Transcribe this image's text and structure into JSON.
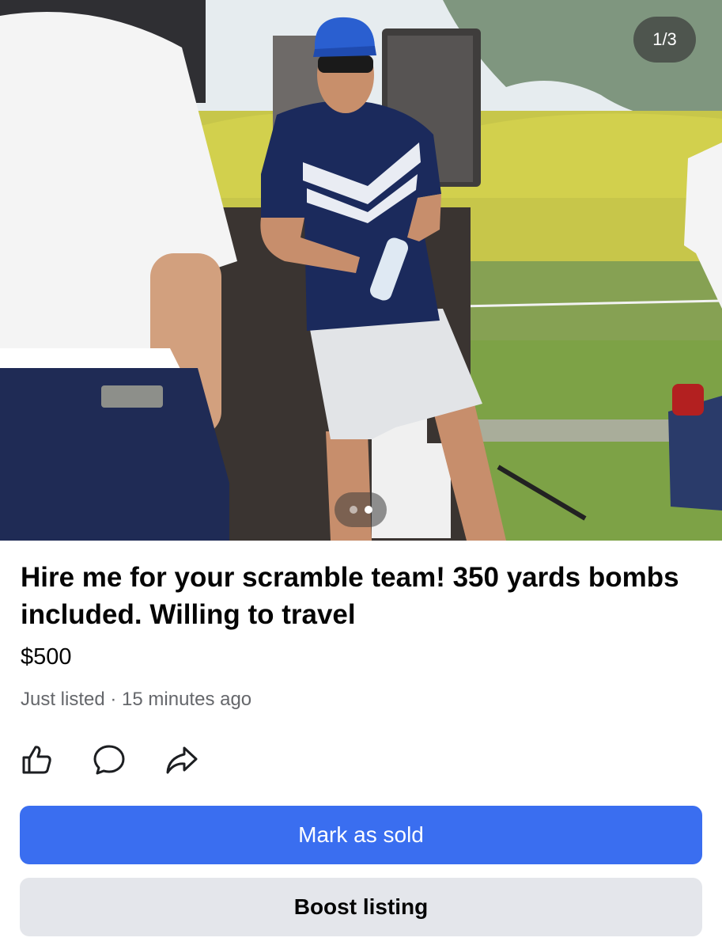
{
  "photo": {
    "counter": "1/3",
    "dots_count": 2,
    "active_dot": 1
  },
  "listing": {
    "title": "Hire me for your scramble team! 350 yards bombs included. Willing to travel",
    "price": "$500",
    "meta": "Just listed · 15 minutes ago"
  },
  "actions": {
    "icons": [
      "thumbs-up-icon",
      "comment-icon",
      "share-icon"
    ]
  },
  "buttons": {
    "mark_sold": "Mark as sold",
    "boost": "Boost listing"
  },
  "colors": {
    "primary": "#3a6ef0",
    "secondary_bg": "#e4e6eb",
    "meta_text": "#65676b"
  }
}
